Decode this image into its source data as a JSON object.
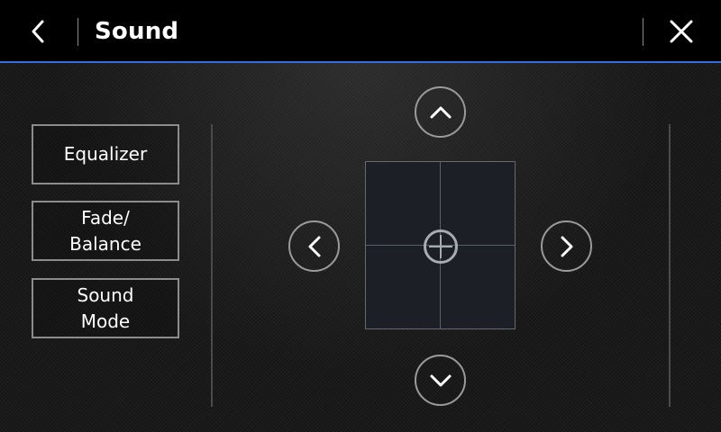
{
  "header": {
    "title": "Sound",
    "back_icon": "chevron-left-icon",
    "close_icon": "close-icon",
    "accent_color": "#2f6fe0"
  },
  "menu": {
    "items": [
      {
        "label": "Equalizer"
      },
      {
        "label": "Fade/\nBalance"
      },
      {
        "label": "Sound\nMode"
      }
    ]
  },
  "fade_balance": {
    "up_icon": "chevron-up-icon",
    "down_icon": "chevron-down-icon",
    "left_icon": "chevron-left-icon",
    "right_icon": "chevron-right-icon",
    "position_marker_icon": "crosshair-icon"
  }
}
